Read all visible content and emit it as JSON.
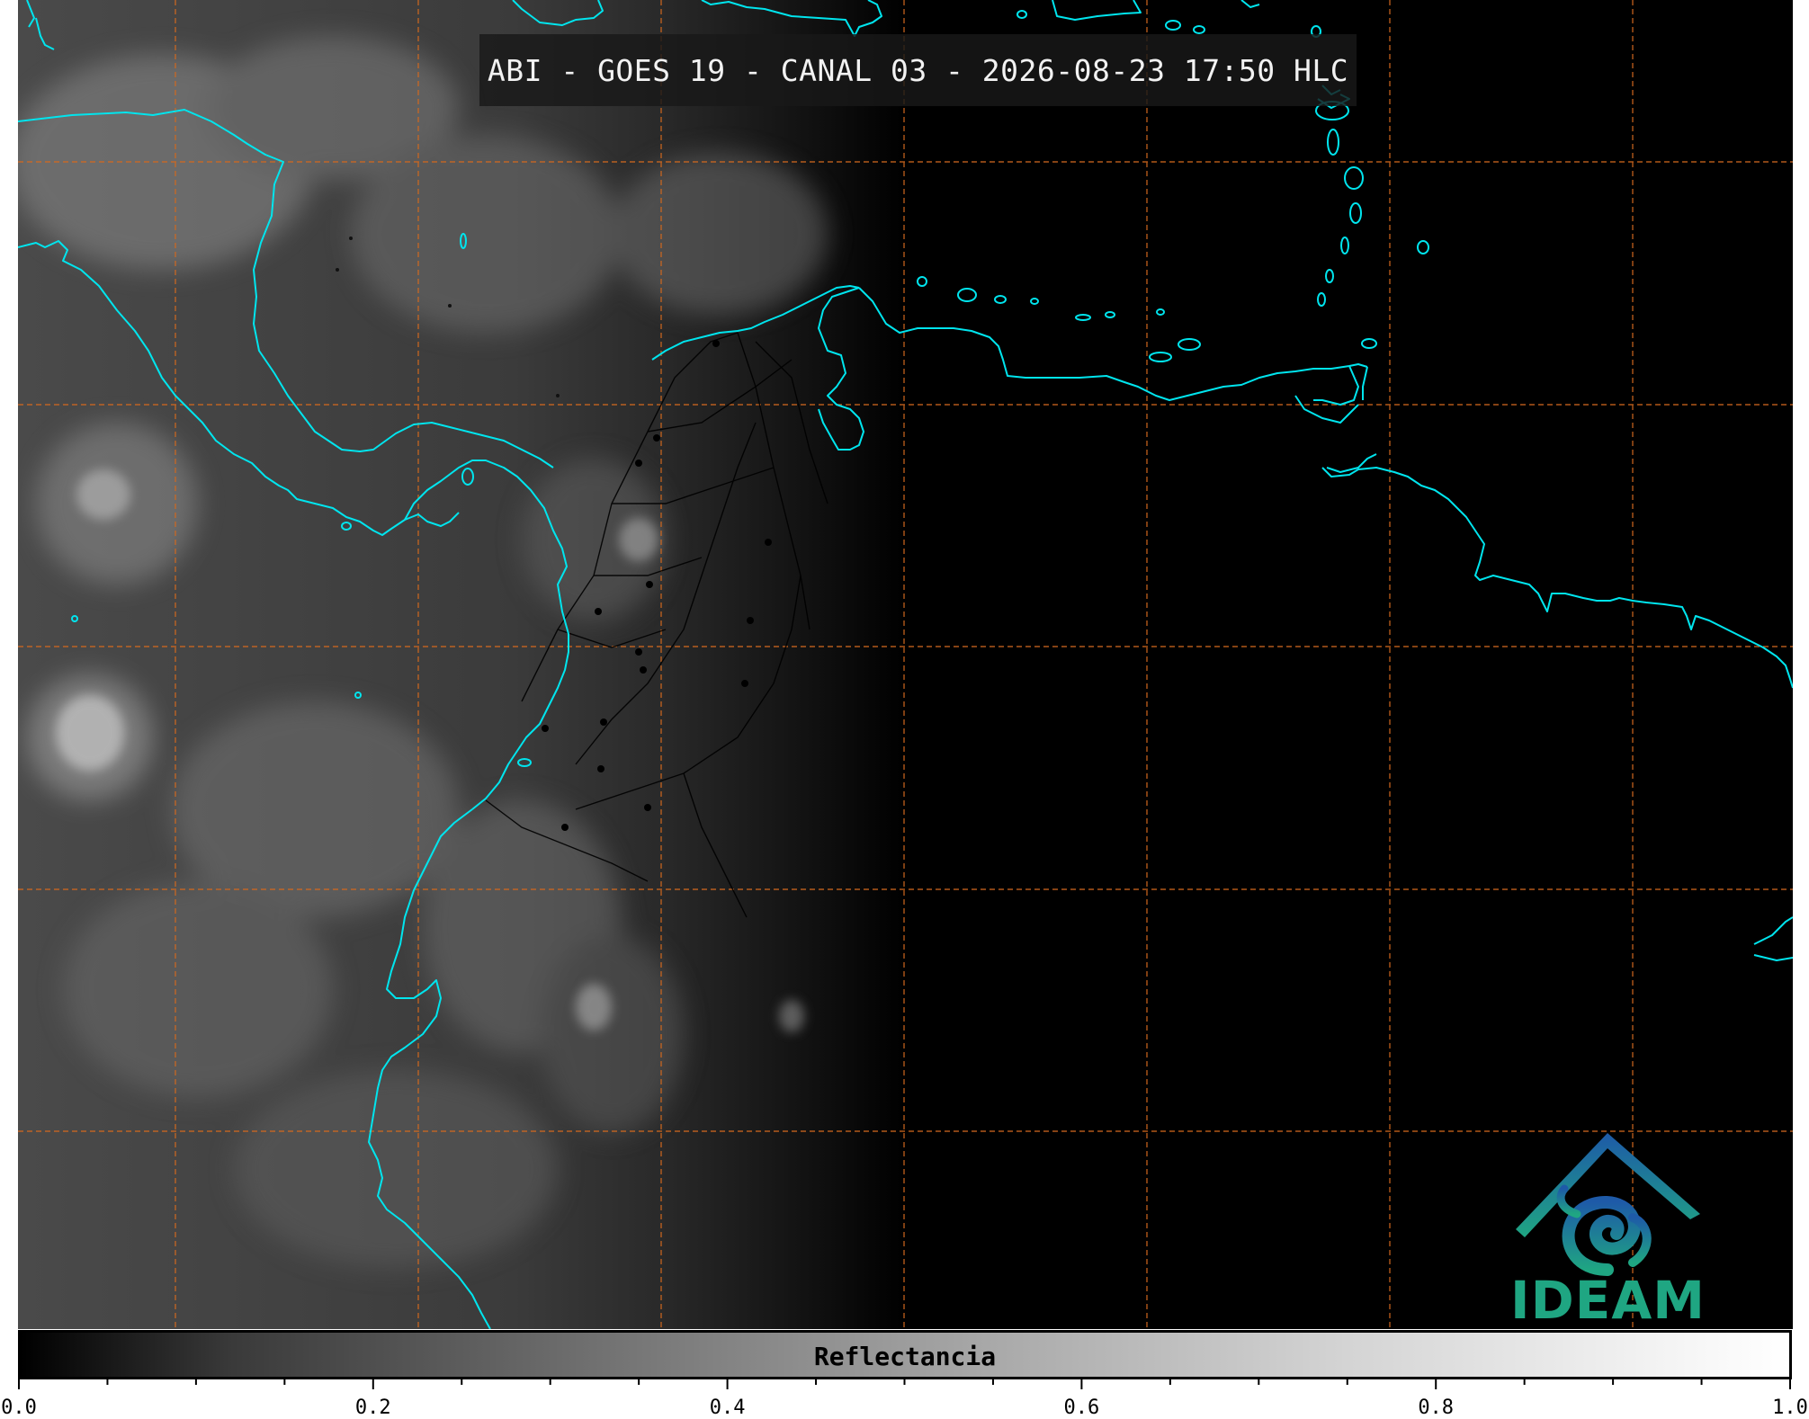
{
  "title": "ABI - GOES 19 - CANAL 03 - 2026-08-23 17:50 HLC",
  "colorbar": {
    "label": "Reflectancia",
    "min": 0.0,
    "max": 1.0,
    "tick_labels": [
      "0.0",
      "0.2",
      "0.4",
      "0.6",
      "0.8",
      "1.0"
    ],
    "minor_ticks_between_labels": 3
  },
  "logo": {
    "text": "IDEAM",
    "colors": {
      "top": "#1e5aa8",
      "bottom": "#1fa682"
    }
  },
  "colors": {
    "coastline": "#00e5ee",
    "gridline": "#d2691e",
    "borders": "#000000",
    "background": "#000000"
  },
  "map": {
    "gridlines": "dashed",
    "day_night_terminator": "visible"
  }
}
